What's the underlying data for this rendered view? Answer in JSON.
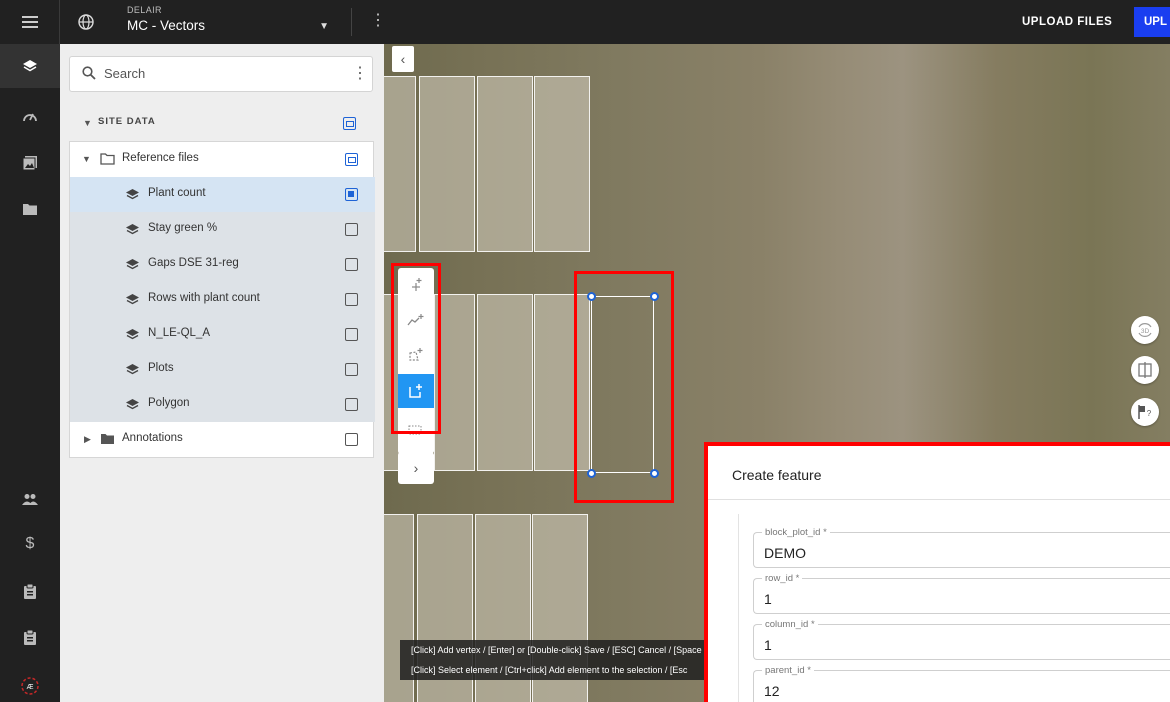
{
  "topbar": {
    "org": "DELAIR",
    "project": "MC - Vectors",
    "upload_files": "UPLOAD FILES",
    "upload_cut": "UPL"
  },
  "panel": {
    "search_placeholder": "Search",
    "site_data": "SITE DATA",
    "reference_files": "Reference files",
    "layers": [
      "Plant count",
      "Stay green %",
      "Gaps DSE 31-reg",
      "Rows with plant count",
      "N_LE-QL_A",
      "Plots",
      "Polygon"
    ],
    "annotations": "Annotations"
  },
  "hints": {
    "line1": "[Click] Add vertex / [Enter] or [Double-click] Save / [ESC] Cancel / [Space",
    "line2": "[Click] Select element / [Ctrl+click] Add element to the selection / [Esc"
  },
  "dialog": {
    "title": "Create feature",
    "fields": [
      {
        "label": "block_plot_id *",
        "value": "DEMO"
      },
      {
        "label": "row_id *",
        "value": "1"
      },
      {
        "label": "column_id *",
        "value": "1"
      },
      {
        "label": "parent_id *",
        "value": "12"
      }
    ]
  },
  "map_controls": {
    "three_d": "3D"
  },
  "colors": {
    "accent": "#1e63d6",
    "upload_button": "#1a3ef0",
    "tool_active": "#2196f3",
    "highlight": "#ff0000"
  }
}
